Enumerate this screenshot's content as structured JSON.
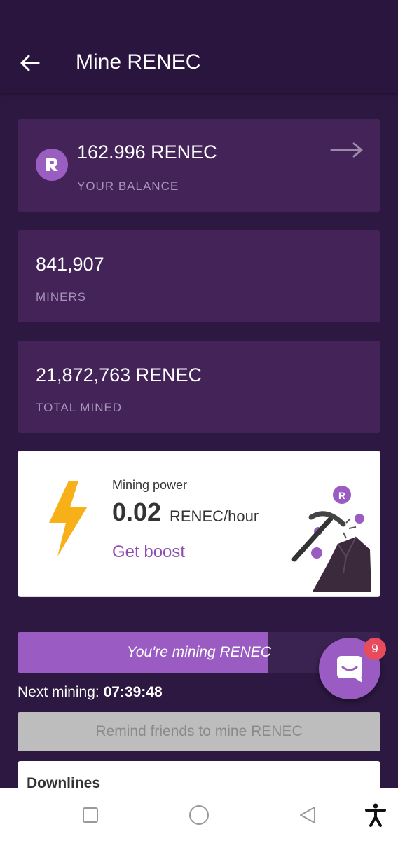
{
  "header": {
    "title": "Mine RENEC"
  },
  "balance": {
    "value": "162.996 RENEC",
    "label": "YOUR BALANCE"
  },
  "miners": {
    "value": "841,907",
    "label": "MINERS"
  },
  "total_mined": {
    "value": "21,872,763 RENEC",
    "label": "TOTAL MINED"
  },
  "mining_power": {
    "label": "Mining power",
    "value": "0.02",
    "unit": "RENEC/hour",
    "boost_label": "Get boost"
  },
  "mining_status": {
    "text": "You're mining RENEC",
    "progress": 0.69
  },
  "next_mining": {
    "label": "Next mining:",
    "time": "07:39:48"
  },
  "remind": {
    "label": "Remind friends to mine RENEC"
  },
  "downlines": {
    "title": "Downlines"
  },
  "chat": {
    "badge_count": "9"
  },
  "colors": {
    "accent": "#9a5cc2",
    "background": "#2c1840",
    "card": "#432358",
    "badge": "#e74c5c",
    "bolt": "#f7b017"
  }
}
